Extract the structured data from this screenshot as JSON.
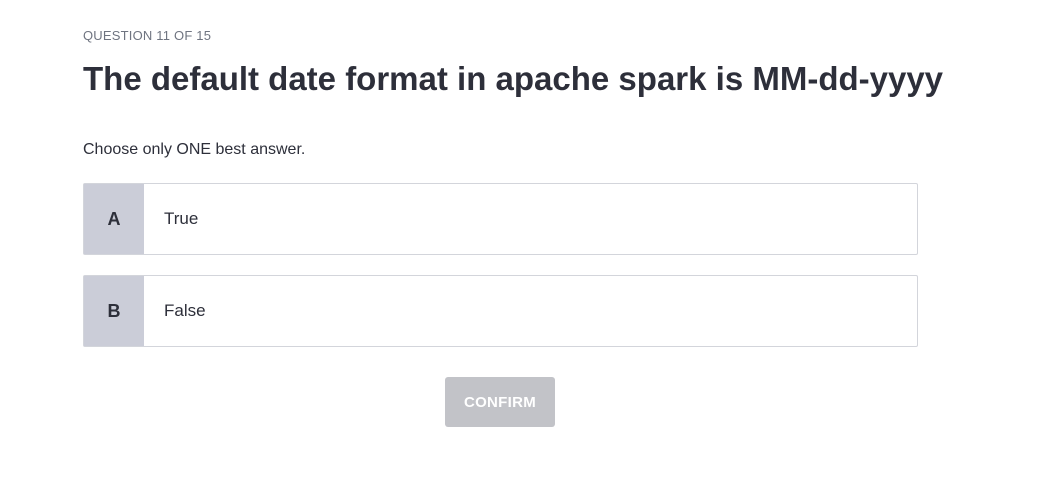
{
  "quiz": {
    "counter": "QUESTION 11 OF 15",
    "question": "The default date format in apache spark is MM-dd-yyyy",
    "instruction": "Choose only ONE best answer.",
    "options": [
      {
        "letter": "A",
        "text": "True"
      },
      {
        "letter": "B",
        "text": "False"
      }
    ],
    "confirm_label": "CONFIRM",
    "confirm_enabled": false
  },
  "colors": {
    "text": "#2d2f3a",
    "muted": "#6f7480",
    "letter_bg": "#cbcdd8",
    "border": "#d3d5db",
    "button_disabled": "#c2c3c8"
  }
}
